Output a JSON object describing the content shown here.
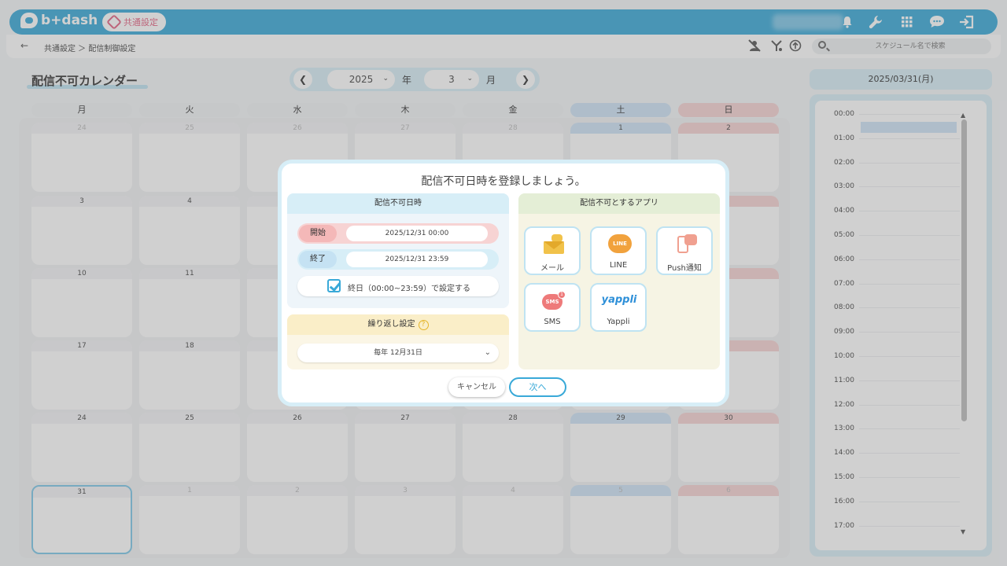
{
  "header": {
    "logo_text": "b+dash",
    "section_label": "共通設定",
    "icons": [
      "bell-icon",
      "wrench-icon",
      "grid-icon",
      "chat-icon",
      "logout-icon"
    ]
  },
  "breadcrumb": {
    "text": "共通設定 ＞ 配信制御設定"
  },
  "search": {
    "placeholder": "スケジュール名で検索"
  },
  "calendar": {
    "title": "配信不可カレンダー",
    "year": "2025",
    "year_unit": "年",
    "month": "3",
    "month_unit": "月",
    "weekdays": [
      "月",
      "火",
      "水",
      "木",
      "金",
      "土",
      "日"
    ],
    "weeks": [
      [
        "24",
        "25",
        "26",
        "27",
        "28",
        "1",
        "2"
      ],
      [
        "3",
        "4",
        "",
        "",
        "",
        "",
        ""
      ],
      [
        "10",
        "11",
        "",
        "",
        "",
        "",
        ""
      ],
      [
        "17",
        "18",
        "",
        "",
        "",
        "",
        ""
      ],
      [
        "24",
        "25",
        "26",
        "27",
        "28",
        "29",
        "30"
      ],
      [
        "31",
        "1",
        "2",
        "3",
        "4",
        "5",
        "6"
      ]
    ]
  },
  "schedule": {
    "date": "2025/03/31(月)",
    "hours": [
      "00:00",
      "01:00",
      "02:00",
      "03:00",
      "04:00",
      "05:00",
      "06:00",
      "07:00",
      "08:00",
      "09:00",
      "10:00",
      "11:00",
      "12:00",
      "13:00",
      "14:00",
      "15:00",
      "16:00",
      "17:00"
    ]
  },
  "modal": {
    "title": "配信不可日時を登録しましょう。",
    "datetime_header": "配信不可日時",
    "start_label": "開始",
    "start_value": "2025/12/31 00:00",
    "end_label": "終了",
    "end_value": "2025/12/31 23:59",
    "allday_label": "終日（00:00~23:59）で設定する",
    "repeat_header": "繰り返し設定",
    "repeat_value": "毎年 12月31日",
    "apps_header": "配信不可とするアプリ",
    "apps": [
      {
        "label": "メール",
        "icon": "mail-icon"
      },
      {
        "label": "LINE",
        "icon": "line-icon"
      },
      {
        "label": "Push通知",
        "icon": "push-icon"
      },
      {
        "label": "SMS",
        "icon": "sms-icon"
      },
      {
        "label": "Yappli",
        "icon": "yappli-icon"
      }
    ],
    "line_icon_text": "LINE",
    "sms_icon_text": "SMS",
    "sms_badge": "1",
    "yappli_logo": "yappli",
    "cancel_label": "キャンセル",
    "next_label": "次へ"
  }
}
